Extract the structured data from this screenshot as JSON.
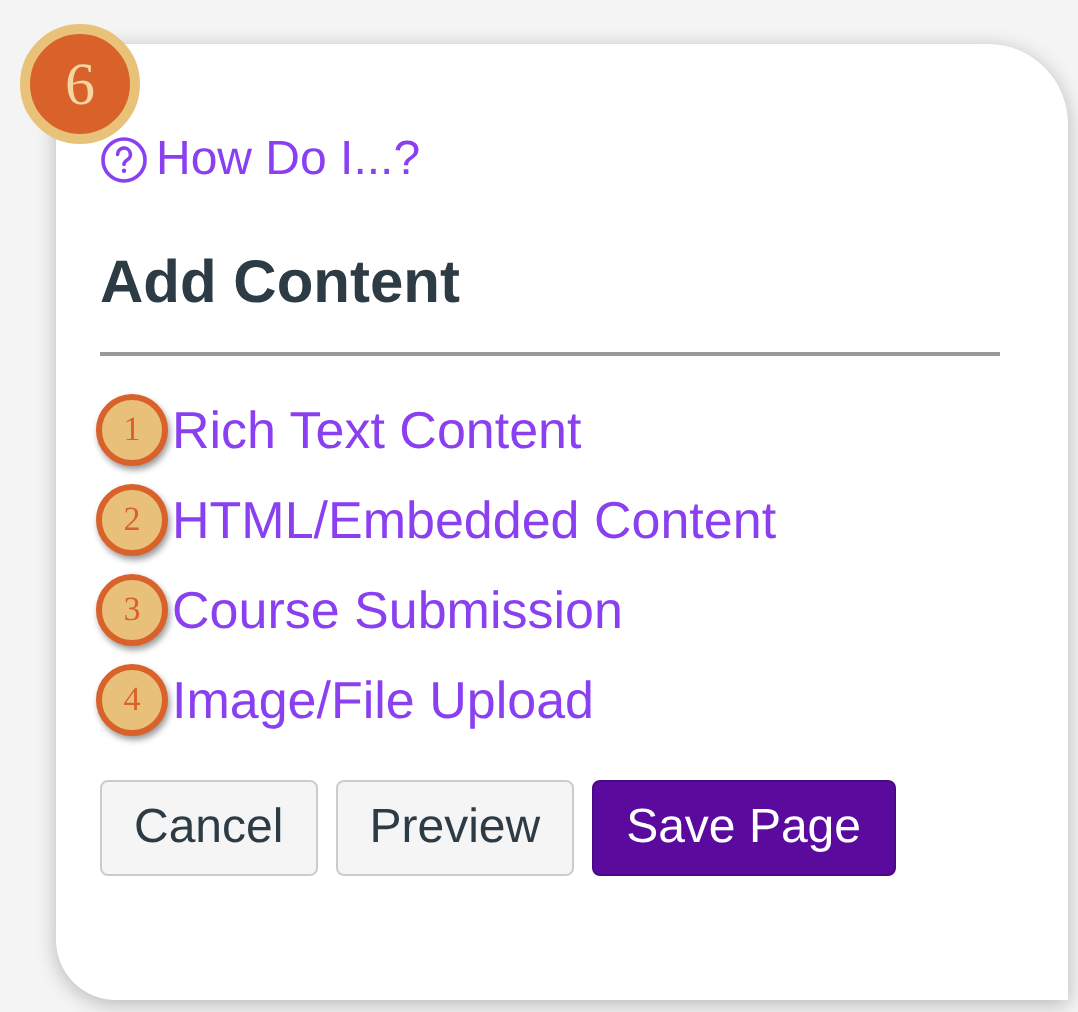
{
  "callout": "6",
  "help_link": {
    "label": "How Do I...?"
  },
  "heading": "Add Content",
  "content_options": [
    {
      "marker": "1",
      "label": "Rich Text Content"
    },
    {
      "marker": "2",
      "label": "HTML/Embedded Content"
    },
    {
      "marker": "3",
      "label": "Course Submission"
    },
    {
      "marker": "4",
      "label": "Image/File Upload"
    }
  ],
  "buttons": [
    {
      "label": "Cancel",
      "kind": "secondary"
    },
    {
      "label": "Preview",
      "kind": "secondary"
    },
    {
      "label": "Save Page",
      "kind": "primary"
    }
  ]
}
